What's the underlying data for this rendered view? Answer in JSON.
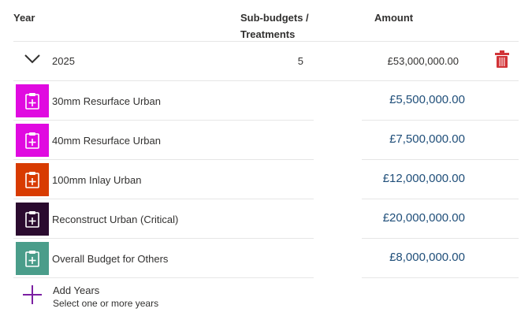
{
  "header": {
    "year": "Year",
    "subbudgets_line1": "Sub-budgets /",
    "subbudgets_line2": "Treatments",
    "amount": "Amount"
  },
  "year_row": {
    "year": "2025",
    "count": "5",
    "total": "£53,000,000.00",
    "expand_icon": "chevron-down-icon",
    "delete_icon": "trash-icon",
    "delete_color": "#d13438"
  },
  "treatments": [
    {
      "label": "30mm Resurface Urban",
      "amount": "£5,500,000.00",
      "color": "#e00ae0",
      "icon": "clipboard-plus-icon"
    },
    {
      "label": "40mm Resurface Urban",
      "amount": "£7,500,000.00",
      "color": "#e00ae0",
      "icon": "clipboard-plus-icon"
    },
    {
      "label": "100mm Inlay Urban",
      "amount": "£12,000,000.00",
      "color": "#d83b01",
      "icon": "clipboard-plus-icon"
    },
    {
      "label": "Reconstruct Urban (Critical)",
      "amount": "£20,000,000.00",
      "color": "#2b0b2f",
      "icon": "clipboard-plus-icon"
    },
    {
      "label": "Overall Budget for Others",
      "amount": "£8,000,000.00",
      "color": "#4a9d8a",
      "icon": "clipboard-plus-icon"
    }
  ],
  "add_years": {
    "title": "Add Years",
    "subtitle": "Select one or more years",
    "icon": "plus-icon",
    "icon_color": "#7b1fa2"
  }
}
